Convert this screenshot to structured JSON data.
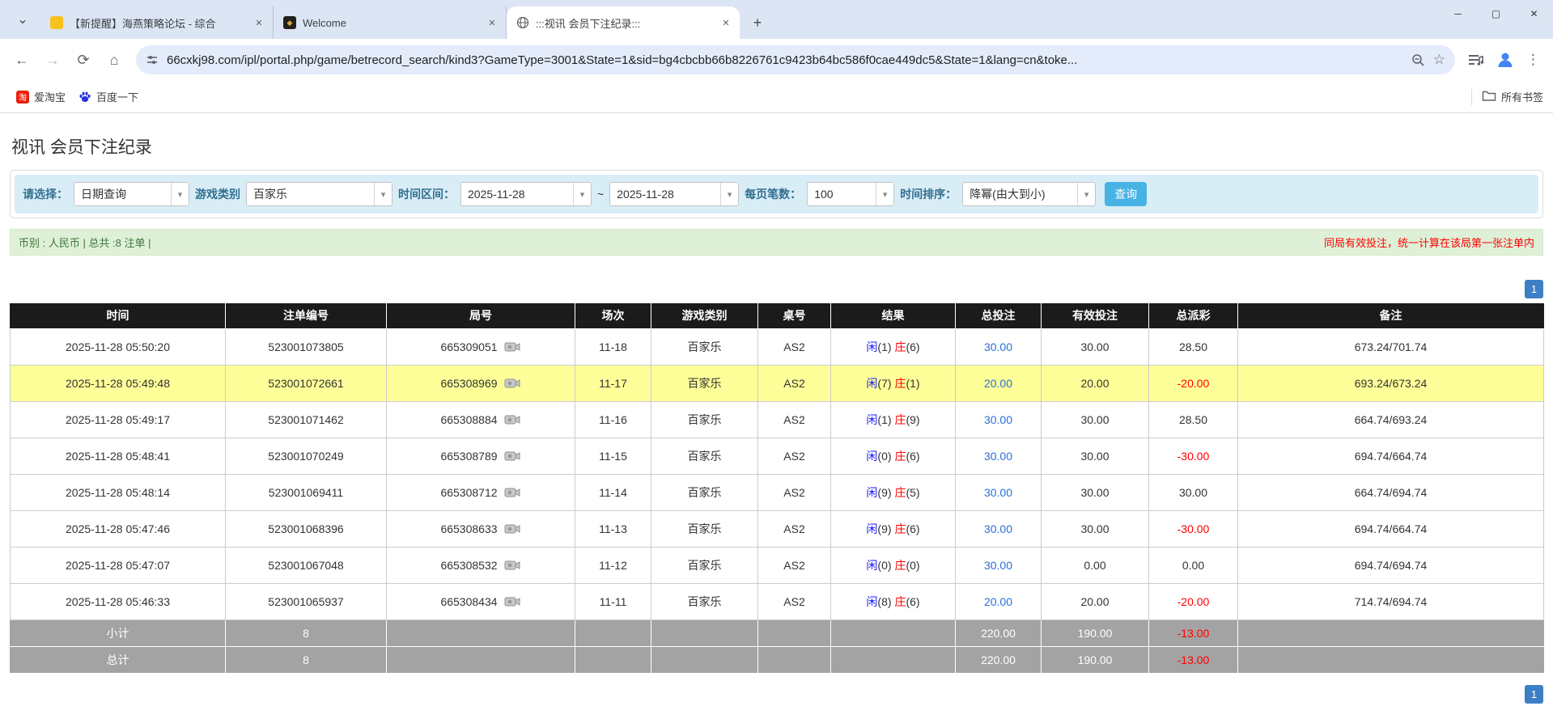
{
  "colors": {
    "tabstrip_bg": "#dce5f4",
    "omnibox_bg": "#e4ecfb",
    "panel_blue": "#d9edf7",
    "filter_label": "#31708f",
    "query_button": "#47b2e4",
    "summary_green_bg": "#dff0d8",
    "summary_green_text": "#3c763d",
    "warning_red": "#ff0000",
    "table_header_bg": "#1b1b1b",
    "highlight_yellow": "#ffff99",
    "subtotal_gray": "#a3a3a3",
    "link_blue": "#2a6fd6",
    "player_blue": "#1a1aff",
    "banker_red": "#ff0000",
    "pagination_blue": "#3d7fc4"
  },
  "glyphs": {
    "tab_search": "⌄",
    "close": "✕",
    "new_tab": "+",
    "minimize": "─",
    "maximize": "▢",
    "back": "←",
    "forward": "→",
    "reload": "⟳",
    "home": "⌂",
    "star": "☆",
    "menu": "⋮",
    "combo_arrow": "▾"
  },
  "browser": {
    "tabs": [
      {
        "title": "【新提醒】海燕策略论坛 - 综合",
        "active": false
      },
      {
        "title": "Welcome",
        "active": false
      },
      {
        "title": ":::视讯 会员下注纪录:::",
        "active": true
      }
    ],
    "url": "66cxkj98.com/ipl/portal.php/game/betrecord_search/kind3?GameType=3001&State=1&sid=bg4cbcbb66b8226761c9423b64bc586f0cae449dc5&State=1&lang=cn&toke...",
    "bookmarks": {
      "items": [
        "爱淘宝",
        "百度一下"
      ],
      "all_label": "所有书签"
    }
  },
  "page": {
    "title": "视讯 会员下注纪录",
    "filters": {
      "select_label": "请选择：",
      "select_value": "日期查询",
      "game_type_label": "游戏类别",
      "game_type_value": "百家乐",
      "date_range_label": "时间区间：",
      "date_from": "2025-11-28",
      "tilde": "~",
      "date_to": "2025-11-28",
      "per_page_label": "每页笔数：",
      "per_page_value": "100",
      "sort_label": "时间排序：",
      "sort_value": "降幂(由大到小)",
      "query_button": "查询"
    },
    "summary": {
      "left": "币别 : 人民币 | 总共 :8 注单 |",
      "right": "同局有效投注，统一计算在该局第一张注单内"
    },
    "pagination": "1",
    "table": {
      "headers": [
        "时间",
        "注单编号",
        "局号",
        "场次",
        "游戏类别",
        "桌号",
        "结果",
        "总投注",
        "有效投注",
        "总派彩",
        "备注"
      ],
      "rows": [
        {
          "time": "2025-11-28 05:50:20",
          "bet_no": "523001073805",
          "round_no": "665309051",
          "session": "11-18",
          "game": "百家乐",
          "table_no": "AS2",
          "player": "闲",
          "player_n": "(1)",
          "banker": "庄",
          "banker_n": "(6)",
          "total_bet": "30.00",
          "valid_bet": "30.00",
          "payout": "28.50",
          "note": "673.24/701.74",
          "highlight": false
        },
        {
          "time": "2025-11-28 05:49:48",
          "bet_no": "523001072661",
          "round_no": "665308969",
          "session": "11-17",
          "game": "百家乐",
          "table_no": "AS2",
          "player": "闲",
          "player_n": "(7)",
          "banker": "庄",
          "banker_n": "(1)",
          "total_bet": "20.00",
          "valid_bet": "20.00",
          "payout": "-20.00",
          "note": "693.24/673.24",
          "highlight": true
        },
        {
          "time": "2025-11-28 05:49:17",
          "bet_no": "523001071462",
          "round_no": "665308884",
          "session": "11-16",
          "game": "百家乐",
          "table_no": "AS2",
          "player": "闲",
          "player_n": "(1)",
          "banker": "庄",
          "banker_n": "(9)",
          "total_bet": "30.00",
          "valid_bet": "30.00",
          "payout": "28.50",
          "note": "664.74/693.24",
          "highlight": false
        },
        {
          "time": "2025-11-28 05:48:41",
          "bet_no": "523001070249",
          "round_no": "665308789",
          "session": "11-15",
          "game": "百家乐",
          "table_no": "AS2",
          "player": "闲",
          "player_n": "(0)",
          "banker": "庄",
          "banker_n": "(6)",
          "total_bet": "30.00",
          "valid_bet": "30.00",
          "payout": "-30.00",
          "note": "694.74/664.74",
          "highlight": false
        },
        {
          "time": "2025-11-28 05:48:14",
          "bet_no": "523001069411",
          "round_no": "665308712",
          "session": "11-14",
          "game": "百家乐",
          "table_no": "AS2",
          "player": "闲",
          "player_n": "(9)",
          "banker": "庄",
          "banker_n": "(5)",
          "total_bet": "30.00",
          "valid_bet": "30.00",
          "payout": "30.00",
          "note": "664.74/694.74",
          "highlight": false
        },
        {
          "time": "2025-11-28 05:47:46",
          "bet_no": "523001068396",
          "round_no": "665308633",
          "session": "11-13",
          "game": "百家乐",
          "table_no": "AS2",
          "player": "闲",
          "player_n": "(9)",
          "banker": "庄",
          "banker_n": "(6)",
          "total_bet": "30.00",
          "valid_bet": "30.00",
          "payout": "-30.00",
          "note": "694.74/664.74",
          "highlight": false
        },
        {
          "time": "2025-11-28 05:47:07",
          "bet_no": "523001067048",
          "round_no": "665308532",
          "session": "11-12",
          "game": "百家乐",
          "table_no": "AS2",
          "player": "闲",
          "player_n": "(0)",
          "banker": "庄",
          "banker_n": "(0)",
          "total_bet": "30.00",
          "valid_bet": "0.00",
          "payout": "0.00",
          "note": "694.74/694.74",
          "highlight": false
        },
        {
          "time": "2025-11-28 05:46:33",
          "bet_no": "523001065937",
          "round_no": "665308434",
          "session": "11-11",
          "game": "百家乐",
          "table_no": "AS2",
          "player": "闲",
          "player_n": "(8)",
          "banker": "庄",
          "banker_n": "(6)",
          "total_bet": "20.00",
          "valid_bet": "20.00",
          "payout": "-20.00",
          "note": "714.74/694.74",
          "highlight": false
        }
      ],
      "subtotal": {
        "label": "小计",
        "count": "8",
        "total_bet": "220.00",
        "valid_bet": "190.00",
        "payout": "-13.00"
      },
      "total": {
        "label": "总计",
        "count": "8",
        "total_bet": "220.00",
        "valid_bet": "190.00",
        "payout": "-13.00"
      }
    }
  }
}
